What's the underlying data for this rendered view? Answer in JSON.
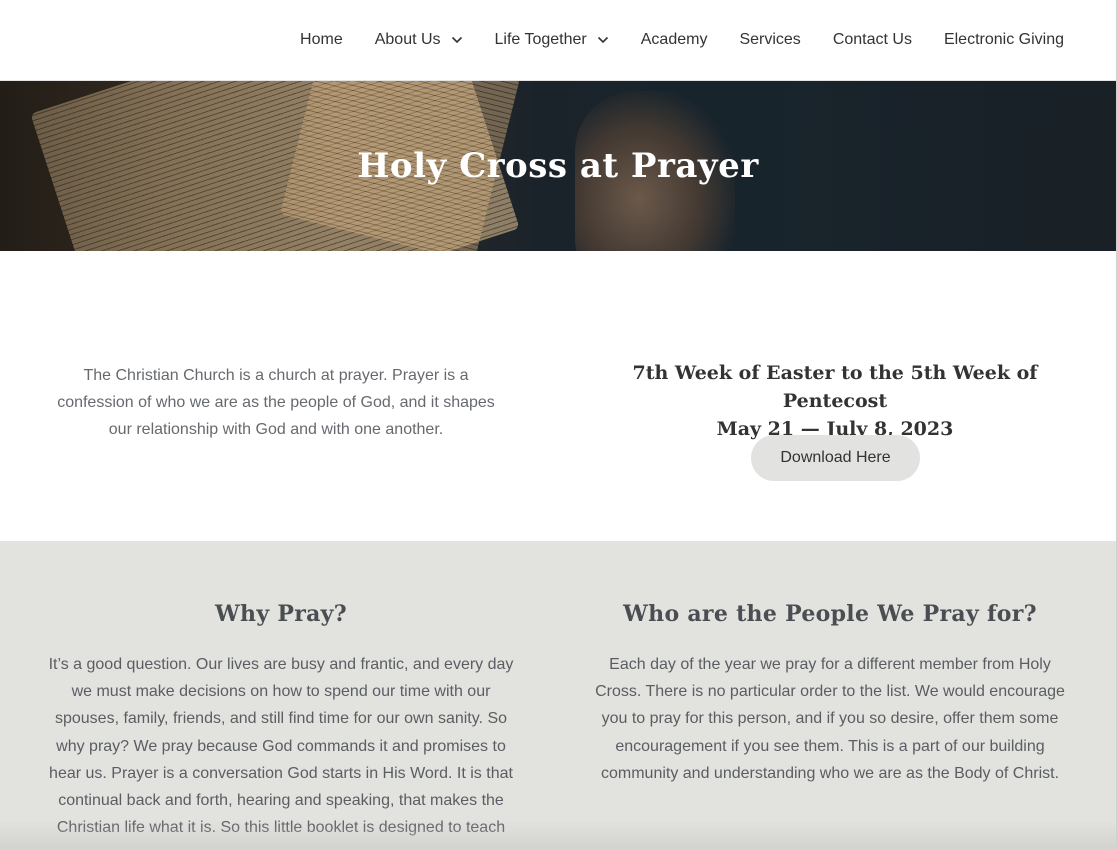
{
  "nav": {
    "items": [
      {
        "label": "Home",
        "has_dropdown": false
      },
      {
        "label": "About Us",
        "has_dropdown": true
      },
      {
        "label": "Life Together",
        "has_dropdown": true
      },
      {
        "label": "Academy",
        "has_dropdown": false
      },
      {
        "label": "Services",
        "has_dropdown": false
      },
      {
        "label": "Contact Us",
        "has_dropdown": false
      },
      {
        "label": "Electronic Giving",
        "has_dropdown": false
      }
    ]
  },
  "hero": {
    "title": "Holy Cross at Prayer"
  },
  "intro": {
    "text": "The Christian Church is a church at prayer. Prayer is a confession of who we are as the people of God, and it shapes our relationship with God and with one another.",
    "week_line1": "7th Week of Easter to the 5th Week of Pentecost",
    "week_line2": "May 21 — July 8, 2023",
    "download_label": "Download Here"
  },
  "why": {
    "title": "Why Pray?",
    "text": "It’s a good question. Our lives are busy and frantic, and every day we must make decisions on how to spend our time with our spouses, family, friends, and still find time for our own sanity. So why pray? We pray because God commands it and promises to hear us. Prayer is a conversation God starts in His Word. It is that continual back and forth, hearing and speaking, that makes the Christian life what it is. So this little booklet is designed to teach"
  },
  "who": {
    "title": "Who are the People We Pray for?",
    "text": "Each day of the year we pray for a different member from Holy Cross. There is no particular order to the list. We would encourage you to pray for this person, and if you so desire, offer them some encouragement if you see them. This is a part of our building community and understanding who we are as the Body of Christ."
  },
  "colors": {
    "hero_bg": "#18242c",
    "lower_bg": "#e2e2df",
    "button_bg": "#e2e2e0",
    "heading": "#333333"
  },
  "icons": {
    "dropdown": "chevron-down-icon"
  }
}
